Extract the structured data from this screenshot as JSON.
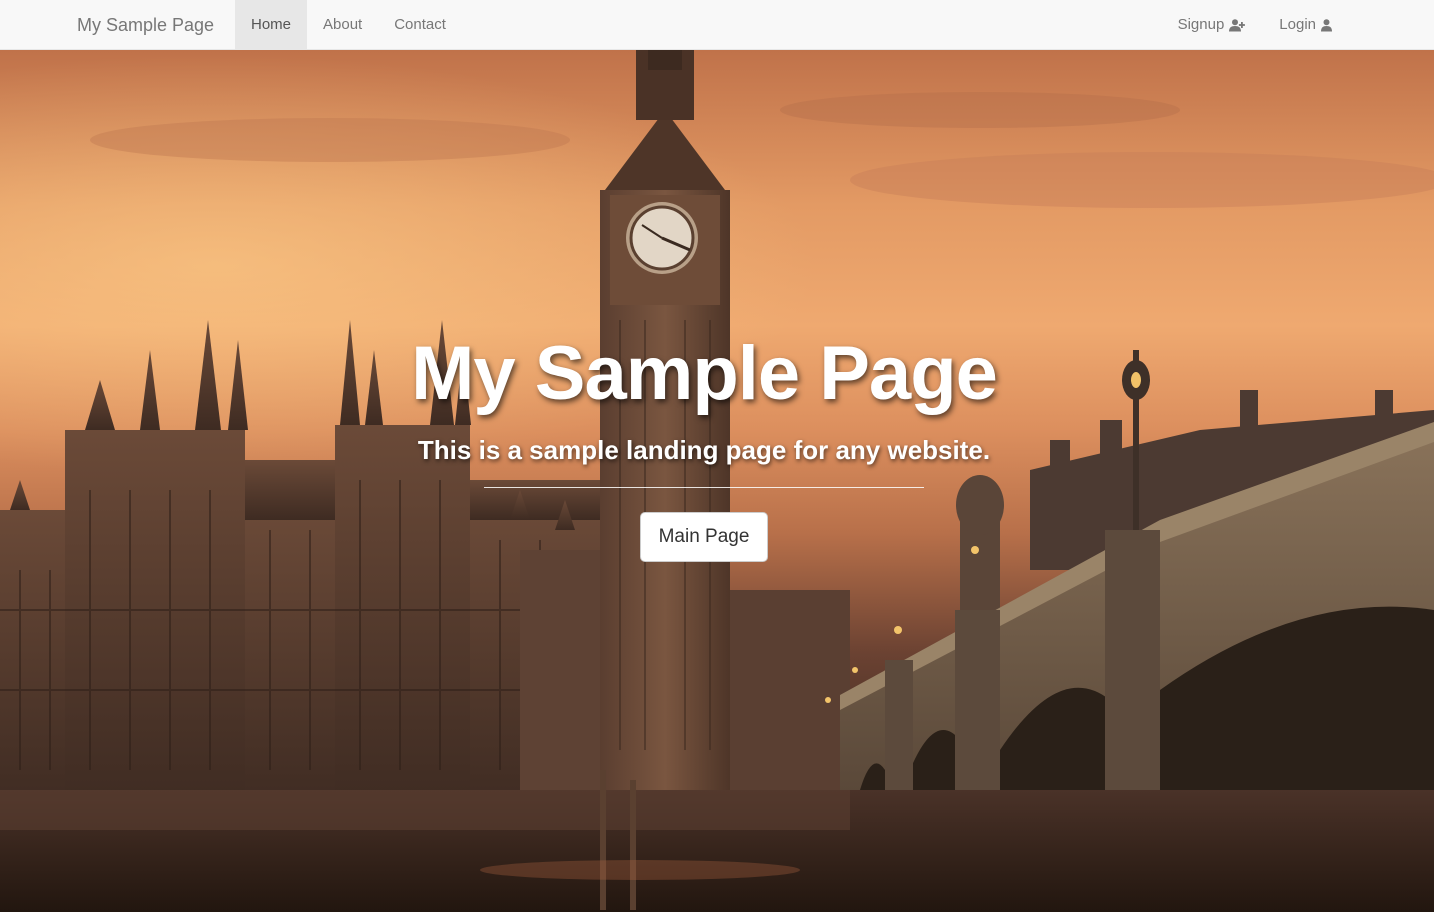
{
  "navbar": {
    "brand": "My Sample Page",
    "links": [
      {
        "label": "Home",
        "active": true
      },
      {
        "label": "About",
        "active": false
      },
      {
        "label": "Contact",
        "active": false
      }
    ],
    "right_links": [
      {
        "label": "Signup",
        "icon": "user-plus-icon"
      },
      {
        "label": "Login",
        "icon": "user-icon"
      }
    ]
  },
  "hero": {
    "title": "My Sample Page",
    "subtitle": "This is a sample landing page for any website.",
    "button_label": "Main Page",
    "background_image": "London sunset: Big Ben, Houses of Parliament and Westminster Bridge"
  },
  "colors": {
    "navbar_bg": "#f8f8f8",
    "nav_text": "#777777",
    "nav_active_bg": "#e7e7e7",
    "hero_text": "#ffffff"
  }
}
